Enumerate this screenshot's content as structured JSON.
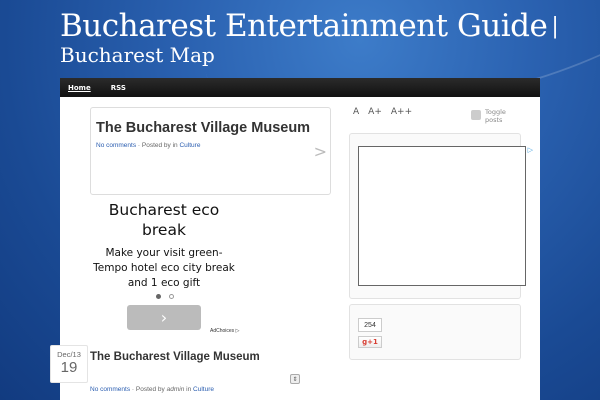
{
  "site": {
    "title": "Bucharest Entertainment Guide",
    "separator": "|",
    "subtitle": "Bucharest Map"
  },
  "nav": {
    "items": [
      {
        "label": "Home"
      },
      {
        "label": "RSS"
      }
    ]
  },
  "featured": {
    "title": "The Bucharest Village Museum",
    "comments": "No comments",
    "posted_by": "· Posted by in",
    "category": "Culture",
    "next_glyph": ">"
  },
  "ad": {
    "title": "Bucharest eco break",
    "body": "Make your visit green- Tempo hotel eco city break and 1 eco gift",
    "button_glyph": "›",
    "adchoices": "AdChoices ▷"
  },
  "post": {
    "month": "Dec/13",
    "day": "19",
    "title": "The Bucharest Village Museum",
    "comments": "No comments",
    "posted_by": "· Posted by",
    "author": "admin",
    "in": "in",
    "category": "Culture"
  },
  "sidebar": {
    "font_sizes": [
      "A",
      "A+",
      "A++"
    ],
    "toggle_label": "Toggle posts",
    "share_count": "254",
    "gplus_label": "g+1"
  },
  "colors": {
    "link": "#2a5db0",
    "background": "#1a4a94",
    "navbar": "#111111"
  }
}
